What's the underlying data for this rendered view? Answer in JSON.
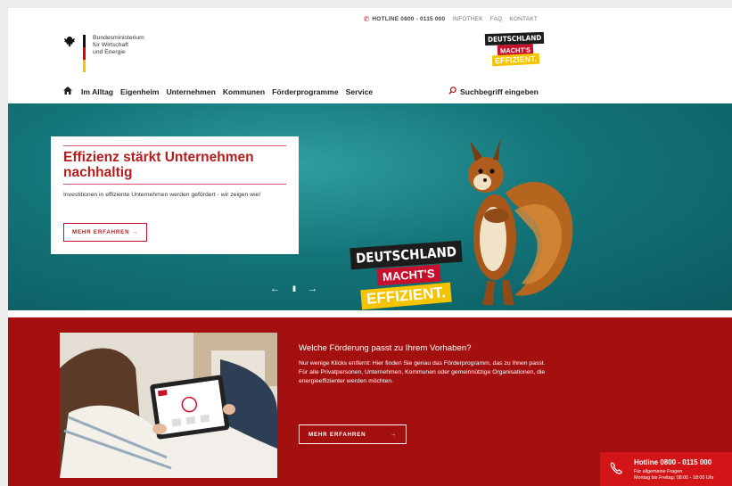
{
  "topbar": {
    "hotline": "HOTLINE 0800 - 0115 000",
    "links": [
      "INFOTHEK",
      "FAQ",
      "KONTAKT"
    ]
  },
  "ministry": {
    "line1": "Bundesministerium",
    "line2": "für Wirtschaft",
    "line3": "und Energie"
  },
  "brand": {
    "line1": "DEUTSCHLAND",
    "line2": "MACHT'S",
    "line3": "EFFIZIENT."
  },
  "nav": {
    "home_icon": "home-icon",
    "items": [
      "Im Alltag",
      "Eigenheim",
      "Unternehmen",
      "Kommunen",
      "Förderprogramme",
      "Service"
    ],
    "search_label": "Suchbegriff eingeben"
  },
  "hero": {
    "title": "Effizienz stärkt Unternehmen nachhaltig",
    "text": "Investitionen in effiziente Unternehmen werden gefördert - wir zeigen wie!",
    "button": "MEHR ERFAHREN →",
    "prev": "←",
    "pause": "II",
    "next": "→"
  },
  "funding": {
    "title": "Welche Förderung passt zu Ihrem Vorhaben?",
    "text": "Nur wenige Klicks entfernt: Hier finden Sie genau das Förderprogramm, das zu Ihnen passt. Für alle Privatpersonen, Unternehmen, Kommunen oder gemeinnützige Organisationen, die energieeffizienter werden möchten.",
    "button": "MEHR ERFAHREN",
    "button_arrow": "→"
  },
  "hotline_box": {
    "title": "Hotline 0800 - 0115 000",
    "sub1": "Für allgemeine Fragen",
    "sub2": "Montag bis Freitag: 08:00 - 18:00 Uhr"
  },
  "colors": {
    "accent_red": "#c8102e",
    "section_red": "#a40f0f",
    "hero_teal": "#137478",
    "brand_yellow": "#f5c400"
  }
}
